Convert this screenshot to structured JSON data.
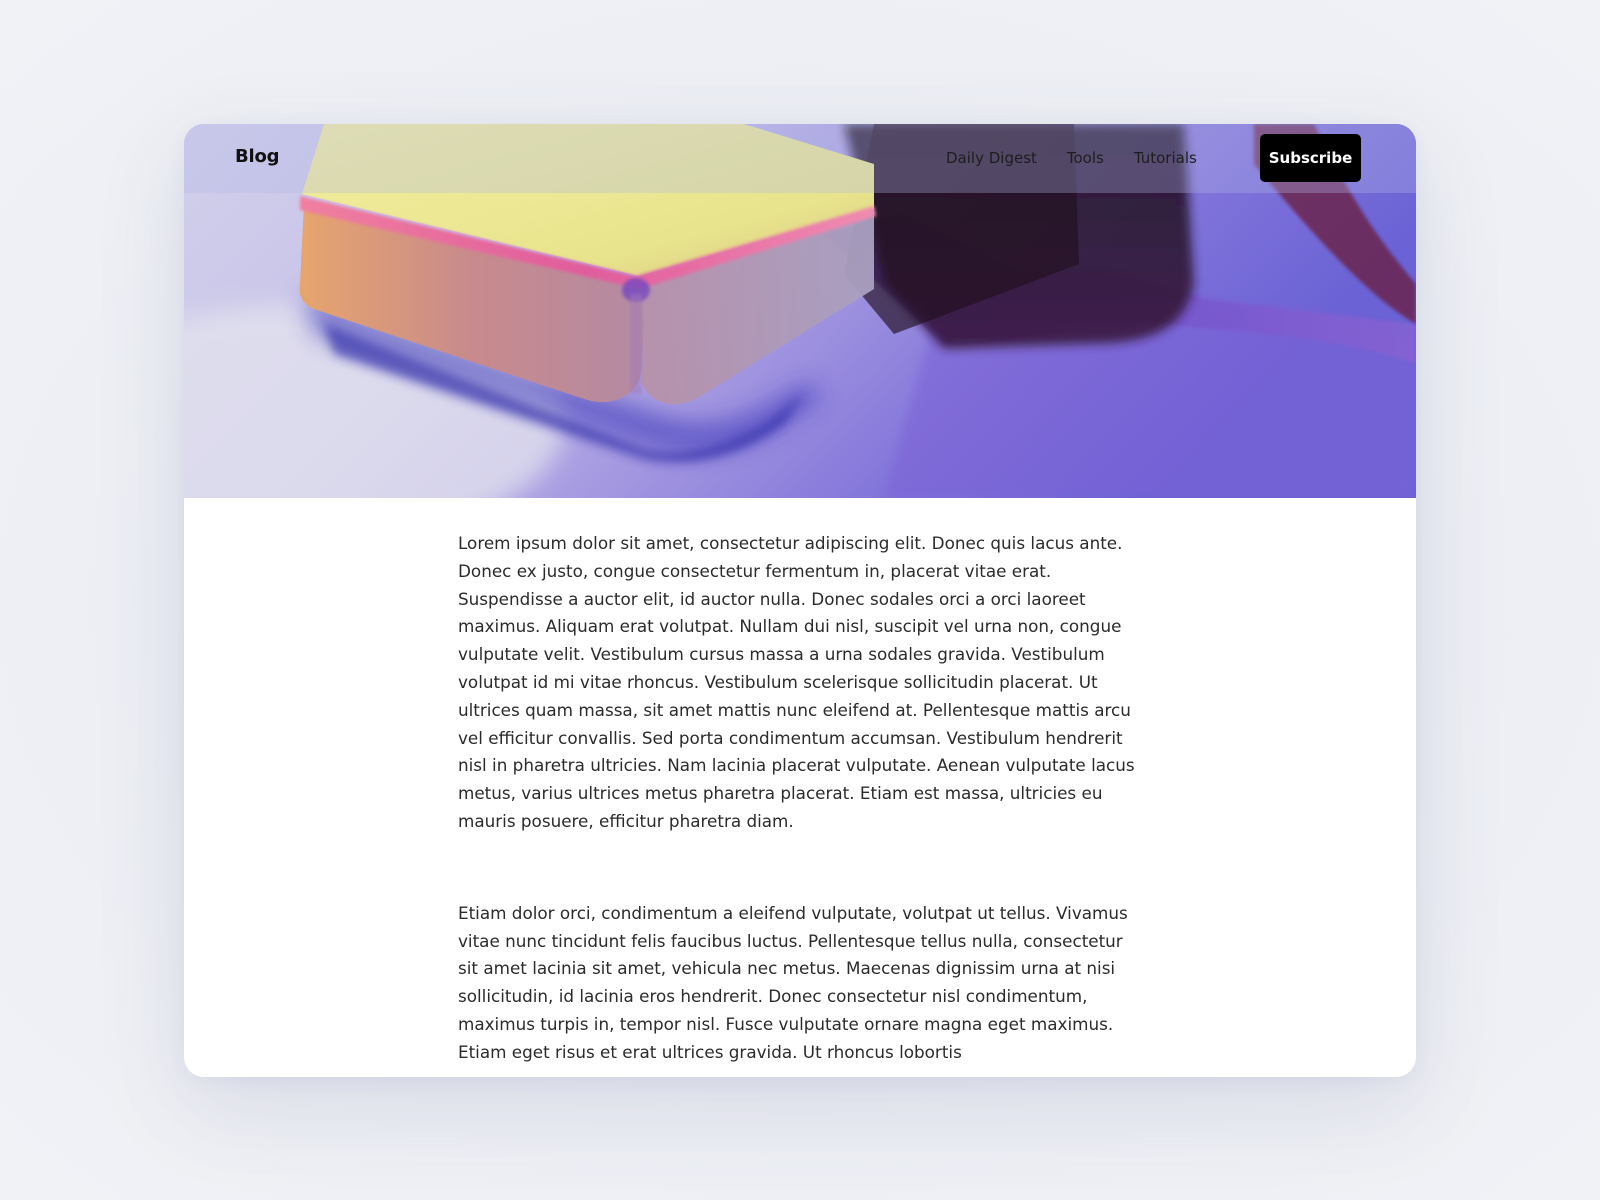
{
  "header": {
    "brand": "Blog",
    "nav": [
      {
        "label": "Daily Digest"
      },
      {
        "label": "Tools"
      },
      {
        "label": "Tutorials"
      }
    ],
    "subscribe_label": "Subscribe"
  },
  "hero": {
    "image": "abstract-3d-shapes"
  },
  "article": {
    "paragraphs": [
      "Lorem ipsum dolor sit amet, consectetur adipiscing elit. Donec quis lacus ante. Donec ex justo, congue consectetur fermentum in, placerat vitae erat. Suspendisse a auctor elit, id auctor nulla. Donec sodales orci a orci laoreet maximus. Aliquam erat volutpat. Nullam dui nisl, suscipit vel urna non, congue vulputate velit. Vestibulum cursus massa a urna sodales gravida. Vestibulum volutpat id mi vitae rhoncus. Vestibulum scelerisque sollicitudin placerat. Ut ultrices quam massa, sit amet mattis nunc eleifend at. Pellentesque mattis arcu vel efficitur convallis. Sed porta condimentum accumsan. Vestibulum hendrerit nisl in pharetra ultricies. Nam lacinia placerat vulputate. Aenean vulputate lacus metus, varius ultrices metus pharetra placerat. Etiam est massa, ultricies eu mauris posuere, efficitur pharetra diam.",
      "Etiam dolor orci, condimentum a eleifend vulputate, volutpat ut tellus. Vivamus vitae nunc tincidunt felis faucibus luctus. Pellentesque tellus nulla, consectetur sit amet lacinia sit amet, vehicula nec metus. Maecenas dignissim urna at nisi sollicitudin, id lacinia eros hendrerit. Donec consectetur nisl condimentum, maximus turpis in, tempor nisl. Fusce vulputate ornare magna eget maximus. Etiam eget risus et erat ultrices gravida. Ut rhoncus lobortis"
    ]
  },
  "colors": {
    "page_background": "#eceef4",
    "card_background": "#ffffff",
    "button_background": "#000000",
    "button_text": "#ffffff",
    "body_text": "#2b2b2b"
  }
}
